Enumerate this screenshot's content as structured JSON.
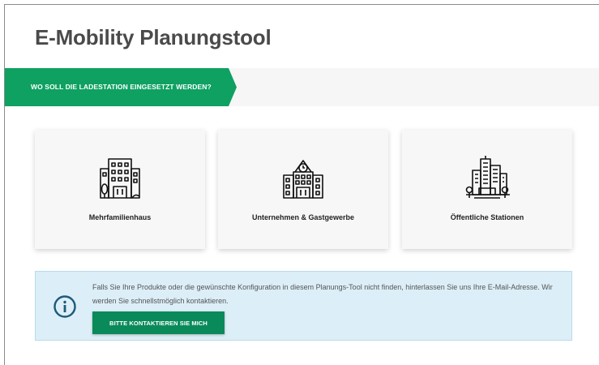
{
  "page": {
    "title": "E-Mobility Planungstool"
  },
  "step": {
    "label": "WO SOLL DIE LADESTATION EINGESETZT WERDEN?",
    "color": "#0ea161"
  },
  "options": [
    {
      "label": "Mehrfamilienhaus",
      "icon": "apartment-building-icon"
    },
    {
      "label": "Unternehmen & Gastgewerbe",
      "icon": "office-building-icon"
    },
    {
      "label": "Öffentliche Stationen",
      "icon": "city-skyline-icon"
    }
  ],
  "info": {
    "icon": "info-icon",
    "text": "Falls Sie Ihre Produkte oder die gewünschte Konfiguration in diesem Planungs-Tool nicht finden, hinterlassen Sie uns Ihre E-Mail-Adresse. Wir werden Sie schnellstmöglich kontaktieren.",
    "button_label": "BITTE KONTAKTIEREN SIE MICH",
    "button_color": "#0a8a5a",
    "background": "#dceef7"
  }
}
